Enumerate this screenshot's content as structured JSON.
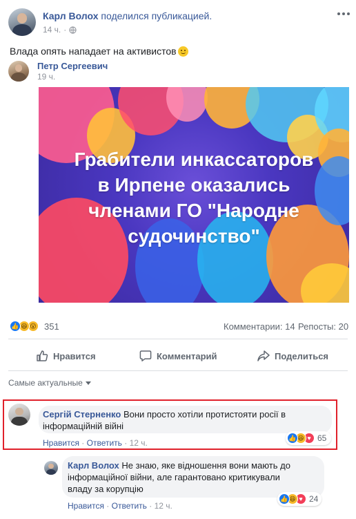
{
  "post": {
    "author": "Карл Волох",
    "action": "поделился публикацией.",
    "time": "14 ч.",
    "privacy_icon": "globe-icon",
    "text": "Влада опять нападает на активистов",
    "emoji": "smiling-face-icon",
    "options_icon": "more-horizontal-icon"
  },
  "shared": {
    "author": "Петр Сергеевич",
    "time": "19 ч.",
    "banner_lines": [
      "Грабители инкассаторов",
      "в Ирпене оказались",
      "членами ГО \"Народне",
      "судочинство\""
    ]
  },
  "stats": {
    "reaction_count": "351",
    "comments": "Комментарии: 14",
    "reposts": "Репосты: 20"
  },
  "actions": {
    "like": "Нравится",
    "comment": "Комментарий",
    "share": "Поделиться"
  },
  "filter": {
    "label": "Самые актуальные"
  },
  "comments": [
    {
      "author": "Сергій Стерненко",
      "text_line1": "Вони просто хотіли протистояти росії в",
      "text_line2": "інформаційній війні",
      "like": "Нравится",
      "reply": "Ответить",
      "time": "12 ч.",
      "reaction_count": "65",
      "highlight_color": "#e0202a"
    },
    {
      "author": "Карл Волох",
      "text_line1": "Не знаю, яке відношення вони мають до",
      "text_line2": "інформаційної війни, але гарантовано критикували",
      "text_line3": "владу за корупцію",
      "like": "Нравится",
      "reply": "Ответить",
      "time": "12 ч.",
      "reaction_count": "24"
    }
  ],
  "colors": {
    "link": "#385898",
    "meta": "#90949c",
    "like_blue": "#1877f2",
    "haha_yellow": "#f7b928",
    "love_red": "#f33e58"
  }
}
